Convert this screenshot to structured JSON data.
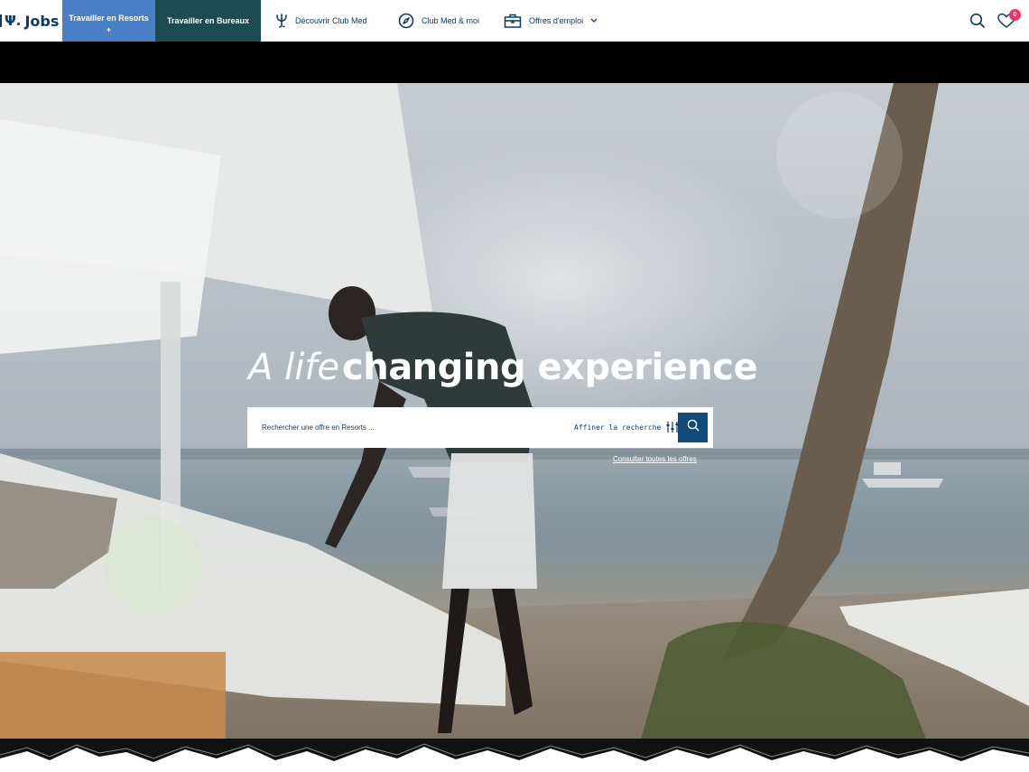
{
  "nav": {
    "logo_text": "Jobs",
    "tab_resorts": "Travailler en Resorts",
    "tab_resorts_sub": "+",
    "tab_bureaux": "Travailler en Bureaux",
    "menu": {
      "discover": "Découvrir Club Med",
      "clubmed_me": "Club Med & moi",
      "offers": "Offres d'emploi"
    },
    "wishlist_count": "0"
  },
  "hero": {
    "headline_light": "A life",
    "headline_bold": "changing experience",
    "search_placeholder": "Rechercher une offre en Resorts ...",
    "refine_label": "Affiner la recherche",
    "all_offers_link": "Consulter toutes les offres"
  },
  "colors": {
    "brand_navy": "#0f3a64",
    "tab_resorts_bg": "#4a7fc7",
    "tab_bureaux_bg": "#1d4b52",
    "search_button_bg": "#0f4a7a",
    "badge": "#e33c6a"
  },
  "icons": {
    "trident": "trident-icon",
    "compass": "compass-icon",
    "briefcase": "briefcase-icon",
    "search": "search-icon",
    "heart": "heart-icon",
    "filter": "filter-icon",
    "chevron": "chevron-down-icon"
  }
}
